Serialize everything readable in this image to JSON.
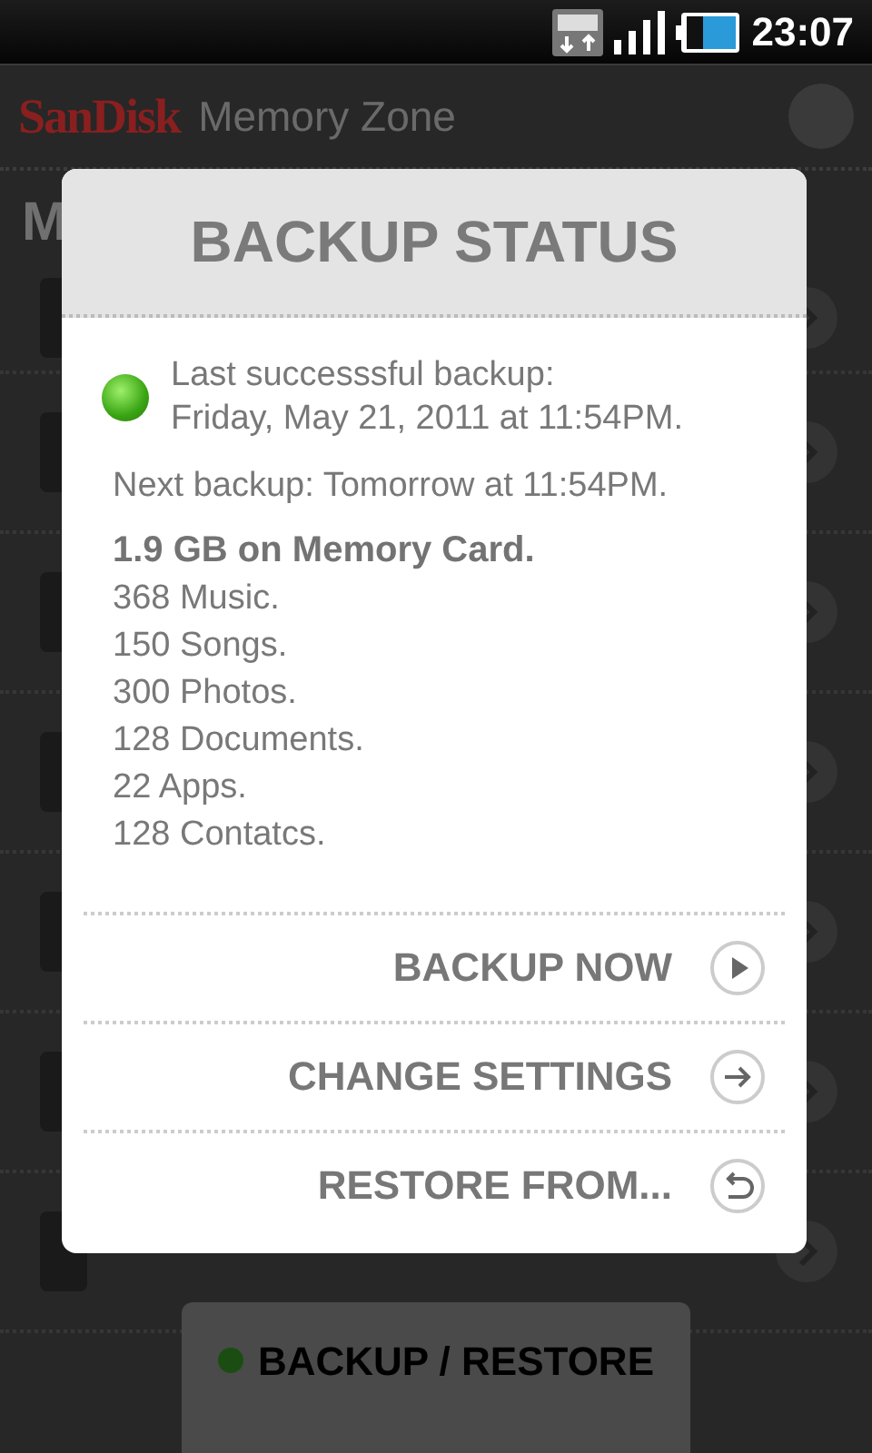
{
  "status_bar": {
    "time": "23:07"
  },
  "header": {
    "logo": "SanDisk",
    "title": "Memory Zone"
  },
  "section_heading": "M",
  "dialog": {
    "title": "BACKUP STATUS",
    "last_backup_label": "Last successsful backup:",
    "last_backup_date": "Friday, May 21, 2011 at 11:54PM.",
    "next_backup": "Next backup: Tomorrow at 11:54PM.",
    "total": "1.9 GB on Memory Card.",
    "counts": [
      "368 Music.",
      "150 Songs.",
      "300 Photos.",
      "128 Documents.",
      "22 Apps.",
      "128 Contatcs."
    ],
    "actions": [
      {
        "label": "BACKUP NOW",
        "kind": "play"
      },
      {
        "label": "CHANGE SETTINGS",
        "kind": "arrow"
      },
      {
        "label": "RESTORE FROM...",
        "kind": "undo"
      }
    ]
  },
  "bottom_button": {
    "label": "BACKUP / RESTORE"
  }
}
